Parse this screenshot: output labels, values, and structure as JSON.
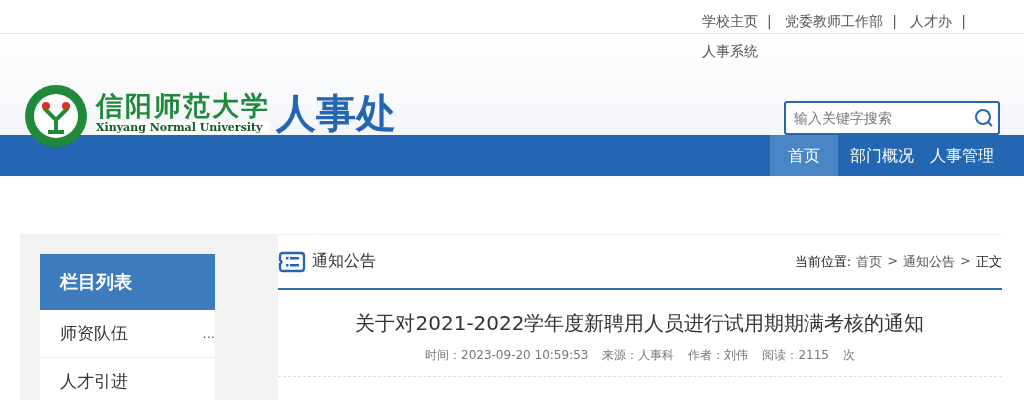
{
  "top_links": {
    "separator": "|",
    "items": [
      {
        "label": "学校主页"
      },
      {
        "label": "党委教师工作部"
      },
      {
        "label": "人才办"
      },
      {
        "label": "人事系统"
      }
    ]
  },
  "logo": {
    "name_cn": "信阳师范大学",
    "name_en": "Xinyang Normal University"
  },
  "site_title": "人事处",
  "search": {
    "placeholder": "输入关键字搜索"
  },
  "nav": [
    {
      "label": "首页",
      "selected": true
    },
    {
      "label": "部门概况",
      "selected": false
    },
    {
      "label": "人事管理",
      "selected": false
    }
  ],
  "sidebar": {
    "heading": "栏目列表",
    "items": [
      {
        "label": "师资队伍",
        "more": "..."
      },
      {
        "label": "人才引进"
      }
    ]
  },
  "section": {
    "title": "通知公告",
    "breadcrumb": {
      "label": "当前位置:",
      "separator": ">",
      "items": [
        "首页",
        "通知公告",
        "正文"
      ]
    }
  },
  "article": {
    "title": "关于对2021-2022学年度新聘用人员进行试用期期满考核的通知",
    "meta": [
      "时间：2023-09-20 10:59:53",
      "来源：人事科",
      "作者：刘伟",
      "阅读：2115",
      "次"
    ]
  }
}
